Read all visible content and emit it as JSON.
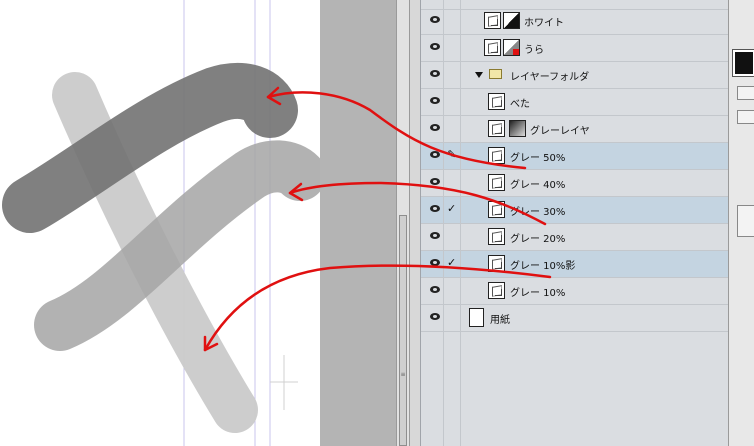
{
  "layers": [
    {
      "name": "ホワイト",
      "thumb": "layer-thumb",
      "swatch": "white-black",
      "visible": true,
      "selected": false,
      "mark": ""
    },
    {
      "name": "うら",
      "thumb": "layer-thumb",
      "swatch": "gray-red",
      "visible": true,
      "selected": false,
      "mark": ""
    },
    {
      "name": "レイヤーフォルダ",
      "thumb": "folder",
      "visible": true,
      "selected": false,
      "mark": ""
    },
    {
      "name": "べた",
      "thumb": "layer-thumb",
      "visible": true,
      "selected": false,
      "mark": ""
    },
    {
      "name": "グレーレイヤ",
      "thumb": "layer-thumb",
      "swatch": "gradient",
      "visible": true,
      "selected": false,
      "mark": ""
    },
    {
      "name": "グレー 50%",
      "thumb": "layer-thumb",
      "visible": true,
      "selected": true,
      "mark": "pen"
    },
    {
      "name": "グレー 40%",
      "thumb": "layer-thumb",
      "visible": true,
      "selected": false,
      "mark": ""
    },
    {
      "name": "グレー 30%",
      "thumb": "layer-thumb",
      "visible": true,
      "selected": true,
      "mark": "check"
    },
    {
      "name": "グレー 20%",
      "thumb": "layer-thumb",
      "visible": true,
      "selected": false,
      "mark": ""
    },
    {
      "name": "グレー 10%影",
      "thumb": "layer-thumb",
      "visible": true,
      "selected": true,
      "mark": "check"
    },
    {
      "name": "グレー 10%",
      "thumb": "layer-thumb",
      "visible": true,
      "selected": false,
      "mark": ""
    },
    {
      "name": "用紙",
      "thumb": "paper",
      "visible": true,
      "selected": false,
      "mark": ""
    }
  ],
  "colors": {
    "selected_row": "#c4d4e1",
    "panel_bg": "#dadde1",
    "annotation_arrow": "#e01010",
    "stroke_50": "#6e6e6e",
    "stroke_30": "#9e9e9e",
    "stroke_10": "#c8c8c8"
  }
}
